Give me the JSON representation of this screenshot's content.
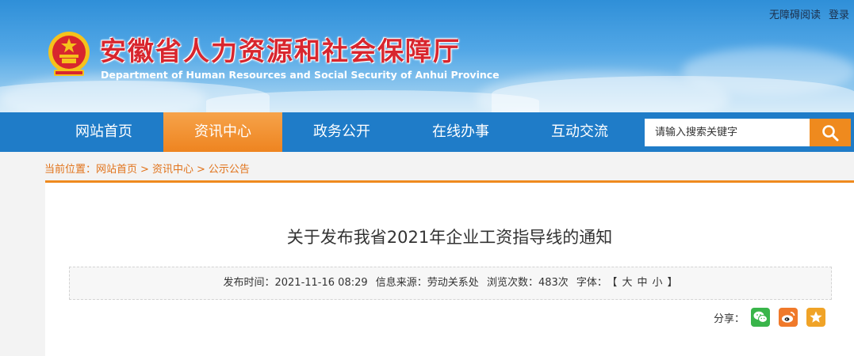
{
  "header": {
    "title": "安徽省人力资源和社会保障厅",
    "subtitle": "Department of Human Resources and Social Security of Anhui Province",
    "links": {
      "accessibility": "无障碍阅读",
      "login": "登录"
    }
  },
  "nav": {
    "items": [
      "网站首页",
      "资讯中心",
      "政务公开",
      "在线办事",
      "互动交流"
    ],
    "active_index": 1,
    "search_placeholder": "请输入搜索关键字"
  },
  "breadcrumb": {
    "prefix": "当前位置：",
    "items": [
      "网站首页",
      "资讯中心",
      "公示公告"
    ],
    "separator": ">"
  },
  "article": {
    "title": "关于发布我省2021年企业工资指导线的通知",
    "meta": {
      "publish_time": "发布时间：2021-11-16 08:29",
      "source": "信息来源：劳动关系处",
      "views": "浏览次数：483次",
      "font_label": "字体：",
      "font_open": "【",
      "font_large": "大",
      "font_medium": "中",
      "font_small": "小",
      "font_close": "】"
    },
    "share_label": "分享：",
    "share_icons": [
      "wechat-icon",
      "weibo-icon",
      "star-icon"
    ]
  },
  "colors": {
    "nav_blue": "#1f7cc8",
    "accent_orange": "#ef8a1e",
    "title_red": "#d8262e",
    "breadcrumb_orange": "#e1731b"
  }
}
